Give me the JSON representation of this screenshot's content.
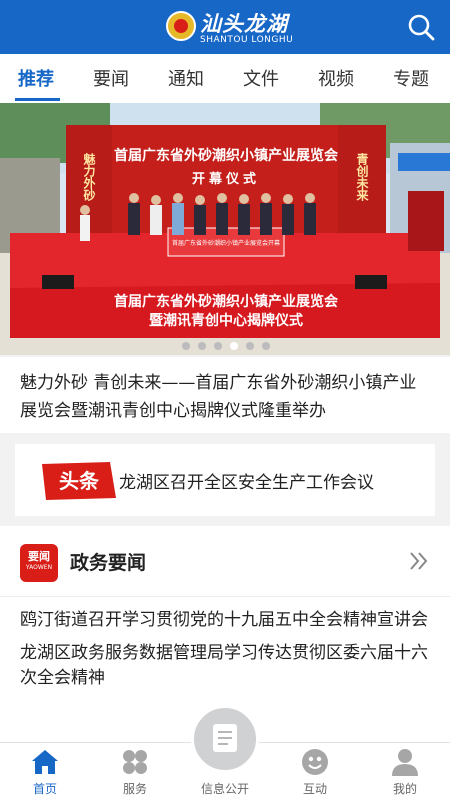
{
  "header": {
    "brand_cn": "汕头龙湖",
    "brand_en": "SHANTOU LONGHU"
  },
  "tabs": [
    {
      "label": "推荐",
      "active": true
    },
    {
      "label": "要闻"
    },
    {
      "label": "通知"
    },
    {
      "label": "文件"
    },
    {
      "label": "视频"
    },
    {
      "label": "专题"
    }
  ],
  "banner": {
    "stage_title_1": "首届广东省外砂潮织小镇产业展览会",
    "stage_title_2": "开幕仪式",
    "left_panel": "魅力外砂",
    "right_panel": "青创未来",
    "bottom_line_1": "首届广东省外砂潮织小镇产业展览会",
    "bottom_line_2": "暨潮讯青创中心揭牌仪式",
    "podium_text": "首届广东省外砂潮织小镇产业展览会开幕",
    "dots_total": 6,
    "active_dot": 4
  },
  "featured": {
    "title": "魅力外砂  青创未来——首届广东省外砂潮织小镇产业展览会暨潮讯青创中心揭牌仪式隆重举办"
  },
  "toutiao": {
    "logo_text": "头条",
    "headline": "龙湖区召开全区安全生产工作会议"
  },
  "section": {
    "icon_cn": "要闻",
    "icon_en": "YAOWEN",
    "title": "政务要闻",
    "items": [
      "鸥汀街道召开学习贯彻党的十九届五中全会精神宣讲会",
      "龙湖区政务服务数据管理局学习传达贯彻区委六届十六次全会精神"
    ]
  },
  "tabbar": [
    {
      "label": "首页",
      "icon": "home-icon",
      "active": true
    },
    {
      "label": "服务",
      "icon": "grid-icon"
    },
    {
      "label": "信息公开",
      "icon": "document-icon"
    },
    {
      "label": "互动",
      "icon": "chat-icon"
    },
    {
      "label": "我的",
      "icon": "user-icon"
    }
  ],
  "colors": {
    "primary": "#1767c7",
    "accent_red": "#d91e18",
    "text": "#222222"
  }
}
